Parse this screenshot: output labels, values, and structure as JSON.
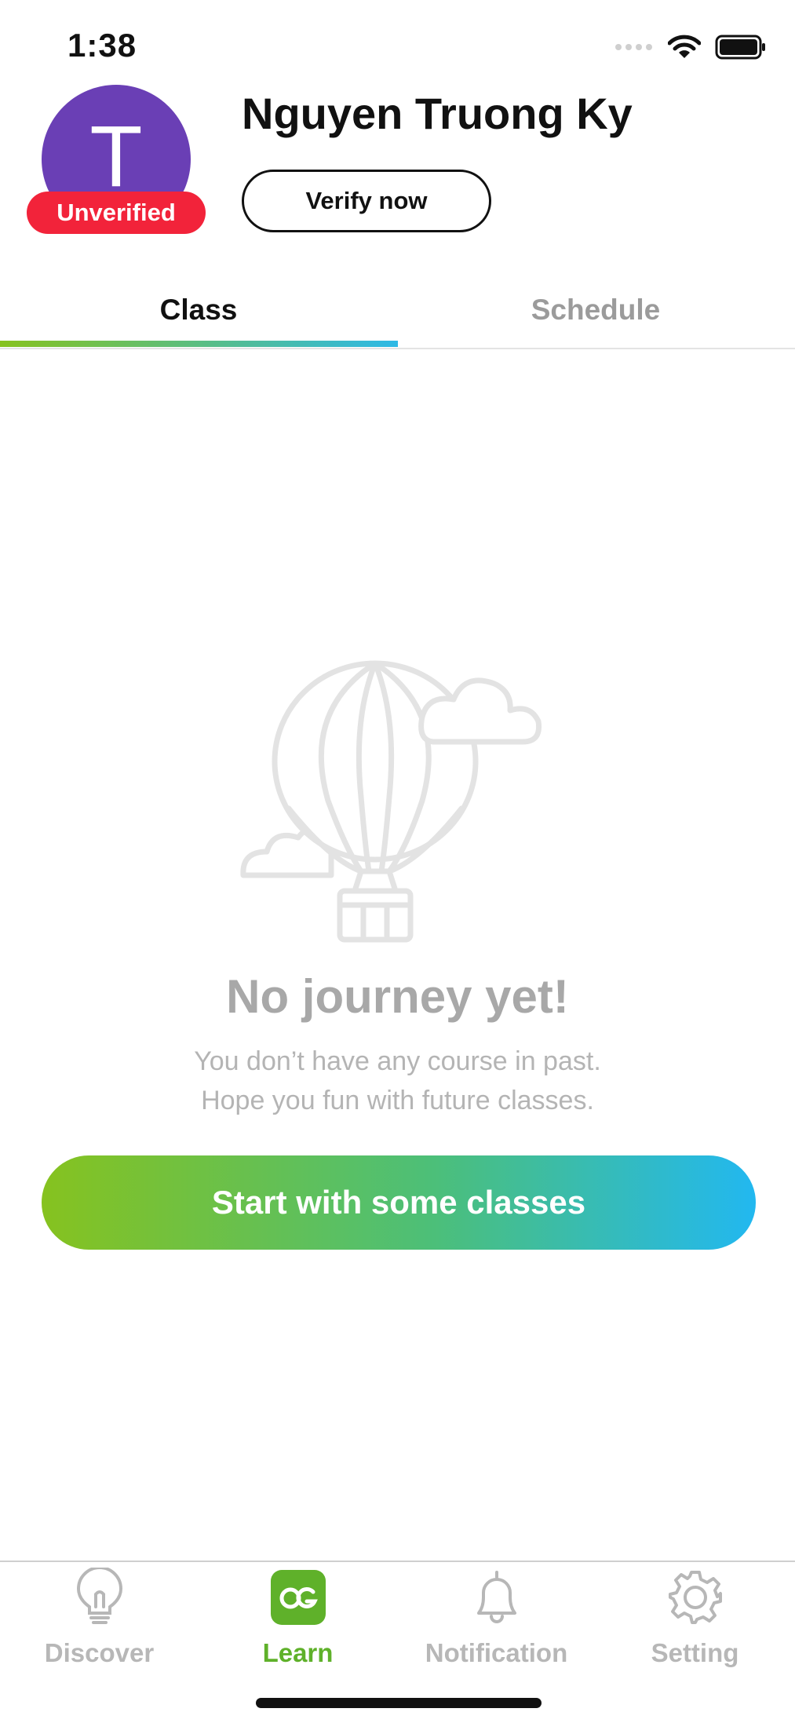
{
  "status_bar": {
    "time": "1:38"
  },
  "profile": {
    "avatar_initial": "T",
    "avatar_color": "#6a3fb5",
    "badge": "Unverified",
    "name": "Nguyen Truong Ky",
    "verify_label": "Verify now"
  },
  "tabs": [
    {
      "label": "Class",
      "active": true
    },
    {
      "label": "Schedule",
      "active": false
    }
  ],
  "empty_state": {
    "icon": "hot-air-balloon-icon",
    "title": "No journey yet!",
    "line1": "You don’t have any course in past.",
    "line2": "Hope you fun with future classes.",
    "cta": "Start with some classes"
  },
  "bottom_nav": [
    {
      "label": "Discover",
      "icon": "lightbulb-icon",
      "active": false
    },
    {
      "label": "Learn",
      "icon": "og-logo-icon",
      "active": true
    },
    {
      "label": "Notification",
      "icon": "bell-icon",
      "active": false
    },
    {
      "label": "Setting",
      "icon": "gear-icon",
      "active": false
    }
  ],
  "colors": {
    "accent_green": "#5fb12a",
    "gradient_start": "#86c21f",
    "gradient_end": "#22b8f0",
    "badge_red": "#f2233a"
  }
}
